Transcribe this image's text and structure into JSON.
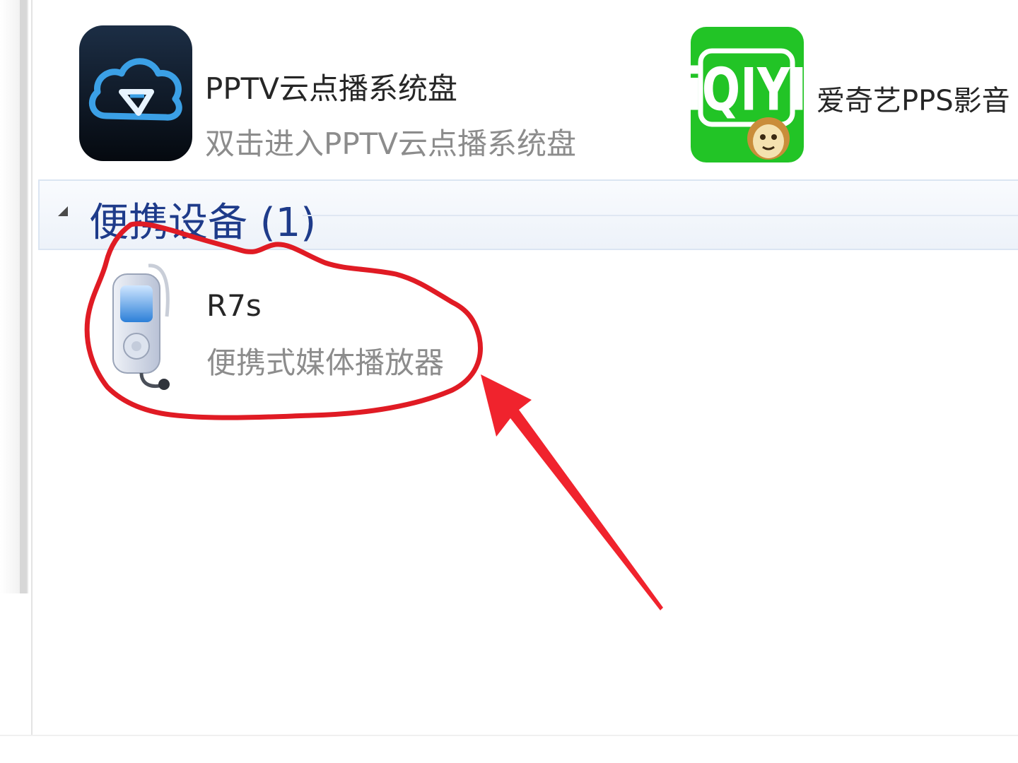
{
  "content": {
    "apps": [
      {
        "name": "PPTV云点播系统盘",
        "description": "双击进入PPTV云点播系统盘",
        "icon": "pptv-cloud-icon"
      },
      {
        "name": "爱奇艺PPS影音",
        "icon": "iqiyi-icon",
        "icon_text": "iQIYI"
      }
    ],
    "group": {
      "title": "便携设备 (1)",
      "collapse_icon": "collapse-arrow-icon"
    },
    "devices": [
      {
        "name": "R7s",
        "type": "便携式媒体播放器",
        "icon": "portable-media-player-icon"
      }
    ]
  },
  "annotations": {
    "highlight_color": "#e01b24",
    "arrow_color": "#f0232d"
  },
  "colors": {
    "group_title": "#1e3b8a",
    "pptv_icon_bg": "#0d1b2b",
    "pptv_icon_accent": "#3ba0e6",
    "iqiyi_green": "#22c426"
  }
}
